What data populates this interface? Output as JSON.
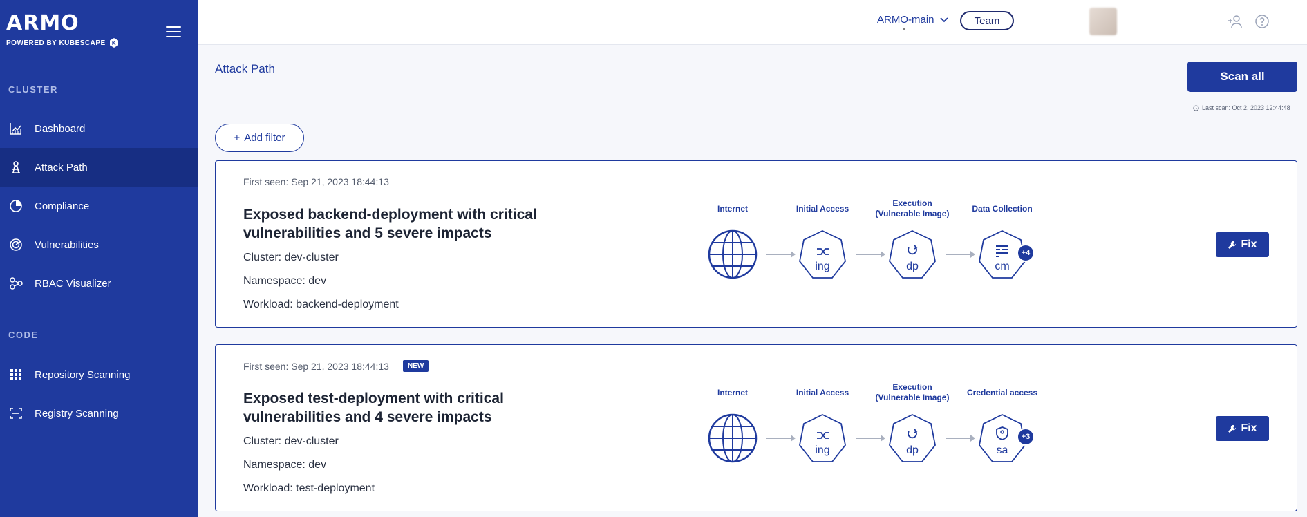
{
  "brand": {
    "logo": "ARMO",
    "tagline": "POWERED BY KUBESCAPE"
  },
  "sidebar": {
    "sections": [
      {
        "label": "CLUSTER"
      },
      {
        "label": "CODE"
      }
    ],
    "items": [
      {
        "label": "Dashboard",
        "icon": "chart-icon"
      },
      {
        "label": "Attack Path",
        "icon": "attack-path-icon",
        "active": true
      },
      {
        "label": "Compliance",
        "icon": "compliance-icon"
      },
      {
        "label": "Vulnerabilities",
        "icon": "radar-icon"
      },
      {
        "label": "RBAC Visualizer",
        "icon": "graph-icon"
      },
      {
        "label": "Repository Scanning",
        "icon": "grid-icon"
      },
      {
        "label": "Registry Scanning",
        "icon": "registry-icon"
      }
    ]
  },
  "topbar": {
    "tenant": "ARMO-main",
    "team_label": "Team"
  },
  "main": {
    "title": "Attack Path",
    "scan_all_label": "Scan all",
    "last_scan": "Last scan: Oct 2, 2023 12:44:48",
    "add_filter_label": "Add filter",
    "fix_label": "Fix"
  },
  "cards": [
    {
      "first_seen": "First seen: Sep 21, 2023 18:44:13",
      "is_new": false,
      "title": "Exposed backend-deployment with critical vulnerabilities and 5 severe impacts",
      "cluster": "Cluster: dev-cluster",
      "namespace": "Namespace: dev",
      "workload": "Workload: backend-deployment",
      "stages": [
        {
          "label": "Internet",
          "node": ""
        },
        {
          "label": "Initial Access",
          "node": "ing"
        },
        {
          "label": "Execution\n(Vulnerable Image)",
          "node": "dp"
        },
        {
          "label": "Data Collection",
          "node": "cm"
        }
      ],
      "more": "+4"
    },
    {
      "first_seen": "First seen: Sep 21, 2023 18:44:13",
      "is_new": true,
      "new_label": "NEW",
      "title": "Exposed test-deployment with critical vulnerabilities and 4 severe impacts",
      "cluster": "Cluster: dev-cluster",
      "namespace": "Namespace: dev",
      "workload": "Workload: test-deployment",
      "stages": [
        {
          "label": "Internet",
          "node": ""
        },
        {
          "label": "Initial Access",
          "node": "ing"
        },
        {
          "label": "Execution\n(Vulnerable Image)",
          "node": "dp"
        },
        {
          "label": "Credential access",
          "node": "sa"
        }
      ],
      "more": "+3"
    }
  ],
  "colors": {
    "primary": "#1f3a9e",
    "sidebar_active": "#172e83",
    "background": "#f6f7fb"
  }
}
